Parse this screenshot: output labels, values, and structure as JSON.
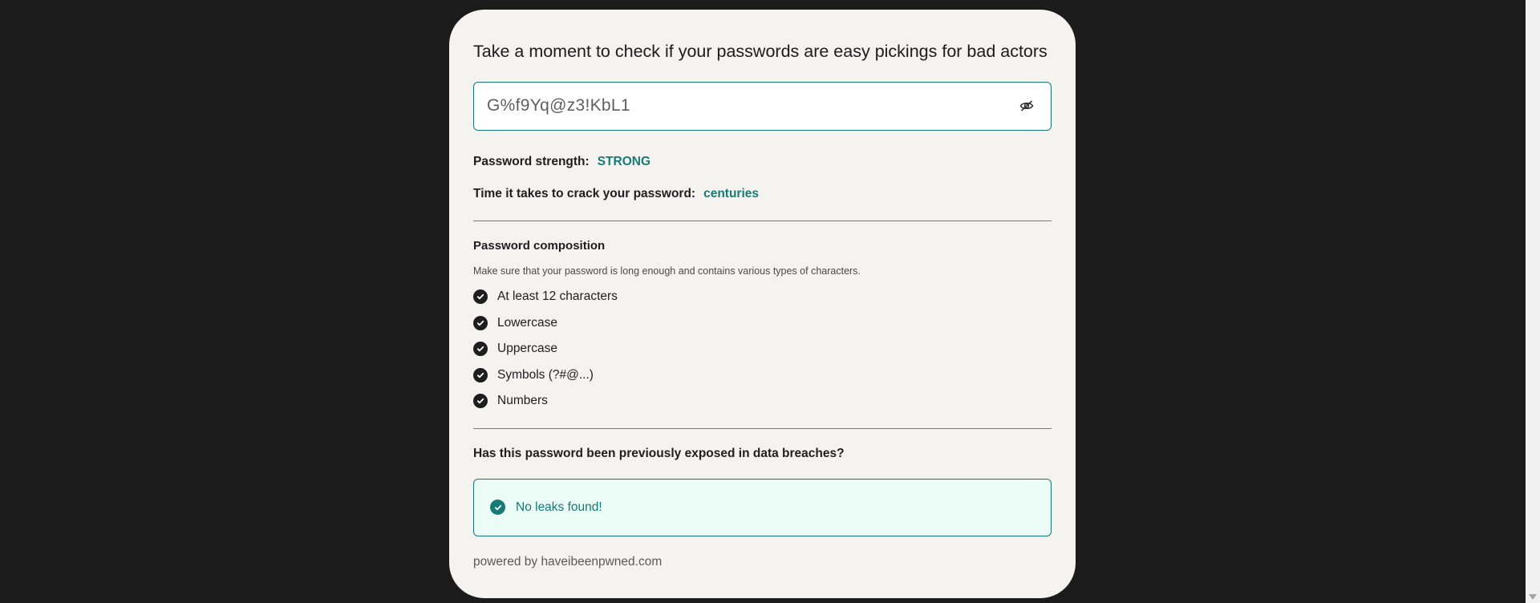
{
  "headline": "Take a moment to check if your passwords are easy pickings for bad actors",
  "password": {
    "value": "G%f9Yq@z3!KbL1",
    "toggle_icon": "eye-slash-icon"
  },
  "strength": {
    "label": "Password strength:",
    "value": "STRONG"
  },
  "crack_time": {
    "label": "Time it takes to crack your password:",
    "value": "centuries"
  },
  "composition": {
    "title": "Password composition",
    "subtitle": "Make sure that your password is long enough and contains various types of characters.",
    "items": [
      {
        "label": "At least 12 characters",
        "icon": "check-circle-icon"
      },
      {
        "label": "Lowercase",
        "icon": "check-circle-icon"
      },
      {
        "label": "Uppercase",
        "icon": "check-circle-icon"
      },
      {
        "label": "Symbols (?#@...)",
        "icon": "check-circle-icon"
      },
      {
        "label": "Numbers",
        "icon": "check-circle-icon"
      }
    ]
  },
  "breach": {
    "question": "Has this password been previously exposed in data breaches?",
    "result": "No leaks found!",
    "result_icon": "check-circle-icon"
  },
  "footer": {
    "powered_by": "powered by haveibeenpwned.com"
  },
  "colors": {
    "background": "#1b1b1b",
    "card": "#f4f3ef",
    "accent": "#167b76",
    "result_bg": "#ebfbf6"
  }
}
